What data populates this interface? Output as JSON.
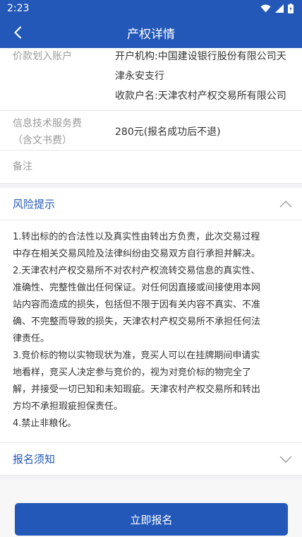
{
  "status_bar": {
    "time": "2:23",
    "icons": [
      "wifi-icon",
      "signal-icon",
      "battery-icon"
    ]
  },
  "nav": {
    "title": "产权详情",
    "back_icon": "chevron-left-icon"
  },
  "account": {
    "label": "价款划入账户",
    "lines": [
      "开户机构:中国建设银行股份有限公司天",
      "津永安支行",
      "收款户名:天津农村产权交易所有限公司"
    ]
  },
  "service_fee": {
    "label_lines": [
      "信息技术服务费",
      "（含文书费）"
    ],
    "value": "280元(报名成功后不退)"
  },
  "remark": {
    "label": "备注",
    "value": ""
  },
  "risk": {
    "title": "风险提示",
    "expanded": true,
    "lines": [
      "1.转出标的的合法性以及真实性由转出方负责，此次交易过程",
      "中存在相关交易风险及法律纠纷由交易双方自行承担并解决。",
      "2.天津农村产权交易所不对农村产权流转交易信息的真实性、",
      "准确性、完整性做出任何保证。对任何因直接或间接使用本网",
      "站内容而造成的损失，包括但不限于因有关内容不真实、不准",
      "确、不完整而导致的损失，天津农村产权交易所不承担任何法",
      "律责任。",
      "3.竞价标的物以实物现状为准，竞买人可以在挂牌期间申请实",
      "地看样，竞买人决定参与竞价的，视为对竞价标的物完全了",
      "解，并接受一切已知和未知瑕疵。天津农村产权交易所和转出",
      "方均不承担瑕疵担保责任。",
      "4.禁止非粮化。"
    ]
  },
  "notice": {
    "title": "报名须知",
    "expanded": false
  },
  "apply": {
    "label": "立即报名"
  },
  "colors": {
    "primary": "#2358b8",
    "label_gray": "#9a9a9a",
    "text": "#333333"
  }
}
